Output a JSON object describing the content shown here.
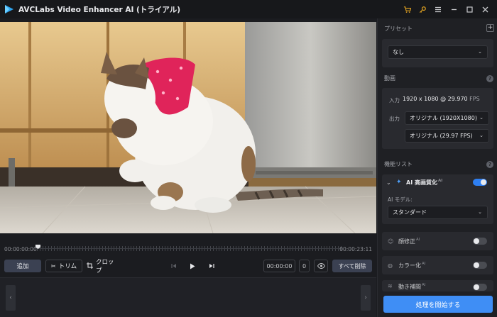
{
  "app": {
    "title": "AVCLabs Video Enhancer AI (トライアル)"
  },
  "titlebar_icons": [
    "cart-icon",
    "key-icon",
    "menu-icon",
    "minimize-icon",
    "maximize-icon",
    "close-icon"
  ],
  "timeline": {
    "start": "00:00:00:00",
    "end": "00:00:23:11"
  },
  "toolbar": {
    "add_label": "追加",
    "trim_label": "トリム",
    "crop_label": "クロップ",
    "time_value": "00:00:00",
    "frame_value": "0",
    "delete_all_label": "すべて削除"
  },
  "panel": {
    "preset": {
      "label": "プリセット",
      "value": "なし"
    },
    "video": {
      "label": "動画",
      "input_label": "入力",
      "input_value": "1920 x 1080 @ 29.970",
      "input_unit": "FPS",
      "output_label": "出力",
      "output_resolution": "オリジナル (1920X1080)",
      "output_fps": "オリジナル (29.97 FPS)"
    },
    "features": {
      "label": "機能リスト",
      "ai_enhance": {
        "name": "AI 高画質化",
        "badge": "AI",
        "enabled": true,
        "model_label": "AI モデル:",
        "model_value": "スタンダード"
      },
      "face": {
        "name": "顔修正",
        "badge": "AI",
        "enabled": false
      },
      "colorize": {
        "name": "カラー化",
        "badge": "AI",
        "enabled": false
      },
      "motion": {
        "name": "動き補間",
        "badge": "AI",
        "enabled": false
      }
    },
    "start_label": "処理を開始する"
  },
  "colors": {
    "accent": "#3f8ef5",
    "toggle_on": "#2e7ff2",
    "bandana": "#e0245a",
    "icon_gold": "#e3a321"
  }
}
